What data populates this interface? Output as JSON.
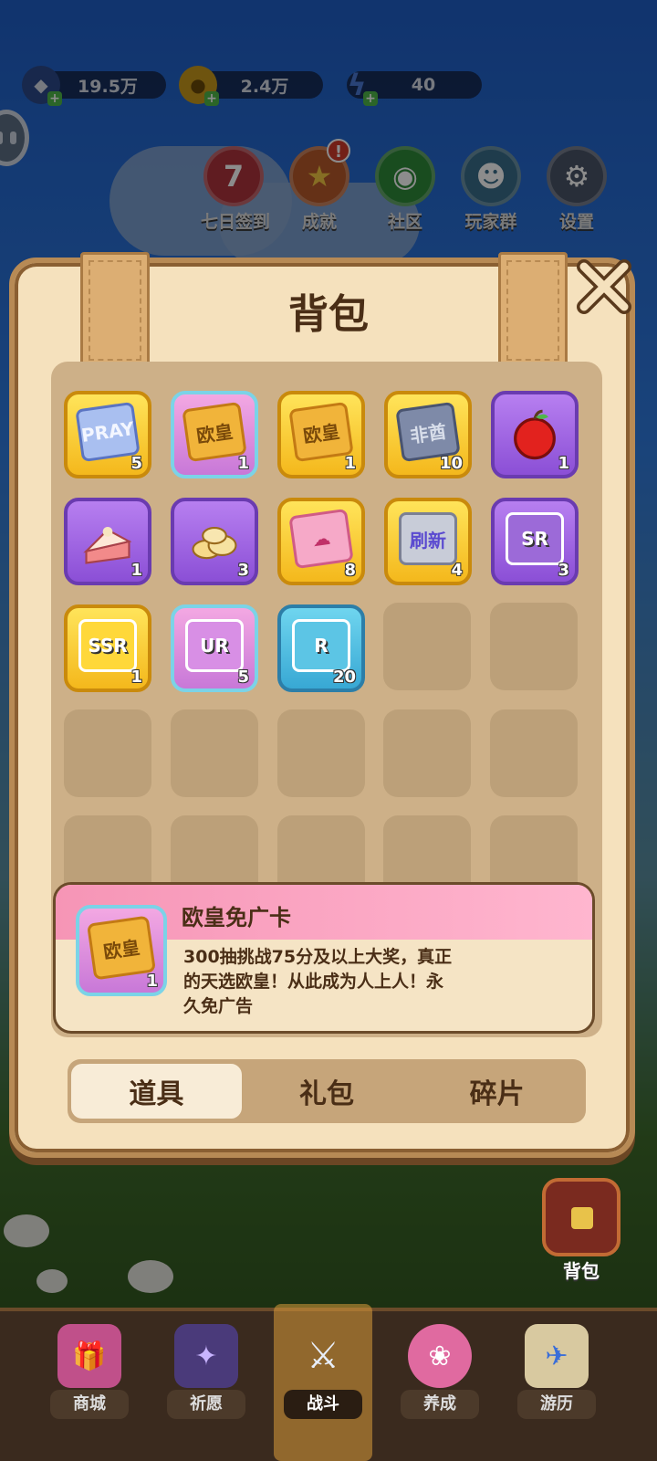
{
  "currencies": [
    {
      "icon": "gem-icon",
      "value": "19.5万"
    },
    {
      "icon": "coin-icon",
      "value": "2.4万"
    },
    {
      "icon": "energy-icon",
      "value": "40"
    }
  ],
  "top_icons": [
    {
      "label": "七日签到",
      "glyph": "7"
    },
    {
      "label": "成就",
      "glyph": "★",
      "badge": "!"
    },
    {
      "label": "社区",
      "glyph": "◉"
    },
    {
      "label": "玩家群",
      "glyph": "☻"
    },
    {
      "label": "设置",
      "glyph": "⚙"
    }
  ],
  "bag": {
    "title": "背包",
    "items": [
      {
        "frame": "gold",
        "art": "PRAY",
        "count": "5"
      },
      {
        "frame": "pink",
        "art": "欧皇",
        "count": "1"
      },
      {
        "frame": "gold",
        "art": "欧皇",
        "count": "1"
      },
      {
        "frame": "gold",
        "art": "非酋",
        "count": "10"
      },
      {
        "frame": "purple",
        "art": "apple",
        "count": "1"
      },
      {
        "frame": "purple",
        "art": "cake",
        "count": "1"
      },
      {
        "frame": "purple",
        "art": "chips",
        "count": "3"
      },
      {
        "frame": "gold",
        "art": "ticket",
        "count": "8"
      },
      {
        "frame": "gold",
        "art": "刷新",
        "count": "4"
      },
      {
        "frame": "purple",
        "art": "SR",
        "count": "3"
      },
      {
        "frame": "gold",
        "art": "SSR",
        "count": "1"
      },
      {
        "frame": "pink",
        "art": "UR",
        "count": "5"
      },
      {
        "frame": "teal",
        "art": "R",
        "count": "20"
      }
    ],
    "tooltip": {
      "name": "欧皇免广卡",
      "icon_art": "欧皇",
      "count": "1",
      "description": "300抽挑战75分及以上大奖，真正的天选欧皇！从此成为人上人！永久免广告"
    },
    "tabs": [
      "道具",
      "礼包",
      "碎片"
    ],
    "active_tab": 0,
    "side_label": "背包"
  },
  "bottom_nav": [
    {
      "label": "商城",
      "icon": "shop-icon"
    },
    {
      "label": "祈愿",
      "icon": "wish-card-icon"
    },
    {
      "label": "战斗",
      "icon": "crossed-swords-icon"
    },
    {
      "label": "养成",
      "icon": "paw-icon"
    },
    {
      "label": "游历",
      "icon": "map-icon"
    }
  ],
  "active_nav": 2,
  "colors": {
    "panel": "#f5e1bd",
    "tooltip_head": "#f695b6",
    "title": "#4a2e16"
  }
}
